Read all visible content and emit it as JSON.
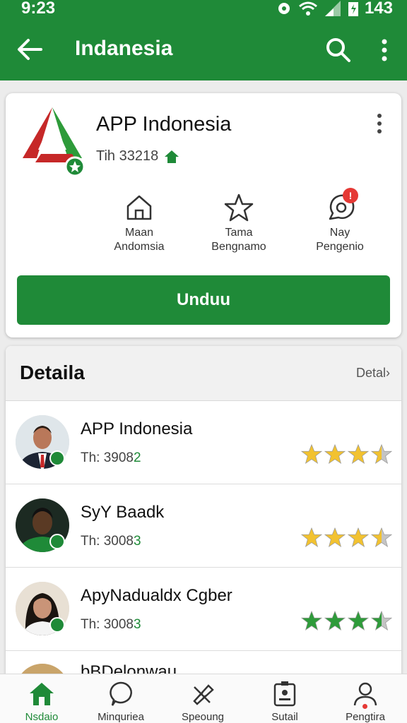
{
  "status_bar": {
    "time": "9:23",
    "battery_text": "143"
  },
  "app_bar": {
    "title": "Indanesia"
  },
  "app_card": {
    "name": "APP Indonesia",
    "subtitle": "Tih 33218",
    "actions": [
      {
        "line1": "Maan",
        "line2": "Andomsia",
        "icon": "home-icon"
      },
      {
        "line1": "Tama",
        "line2": "Bengnamo",
        "icon": "star-icon"
      },
      {
        "line1": "Nay",
        "line2": "Pengenio",
        "icon": "chat-icon",
        "badge": "!"
      }
    ],
    "download_label": "Unduu"
  },
  "details": {
    "title": "Detaila",
    "link": "Detal›",
    "rows": [
      {
        "name": "APP Indonesia",
        "sub_prefix": "Th: 3908",
        "sub_accent": "2",
        "rating": 3.5
      },
      {
        "name": "SyY Baadk",
        "sub_prefix": "Th: 3008",
        "sub_accent": "3",
        "rating": 3.5
      },
      {
        "name": "ApyNadualdx Cgber",
        "sub_prefix": "Th: 3008",
        "sub_accent": "3",
        "rating": 3.5
      }
    ],
    "partial_row_name": "bBDelonwau"
  },
  "bottom_nav": [
    {
      "label": "Nsdaio",
      "icon": "home-icon",
      "active": true
    },
    {
      "label": "Minquriea",
      "icon": "chat-bubble-icon",
      "active": false
    },
    {
      "label": "Speoung",
      "icon": "tools-icon",
      "active": false
    },
    {
      "label": "Sutail",
      "icon": "device-icon",
      "active": false
    },
    {
      "label": "Pengtira",
      "icon": "person-icon",
      "active": false
    }
  ],
  "colors": {
    "primary": "#1f8a38",
    "star_gold": "#f2c230",
    "star_green": "#2e9b3a",
    "alert_red": "#e53935"
  }
}
